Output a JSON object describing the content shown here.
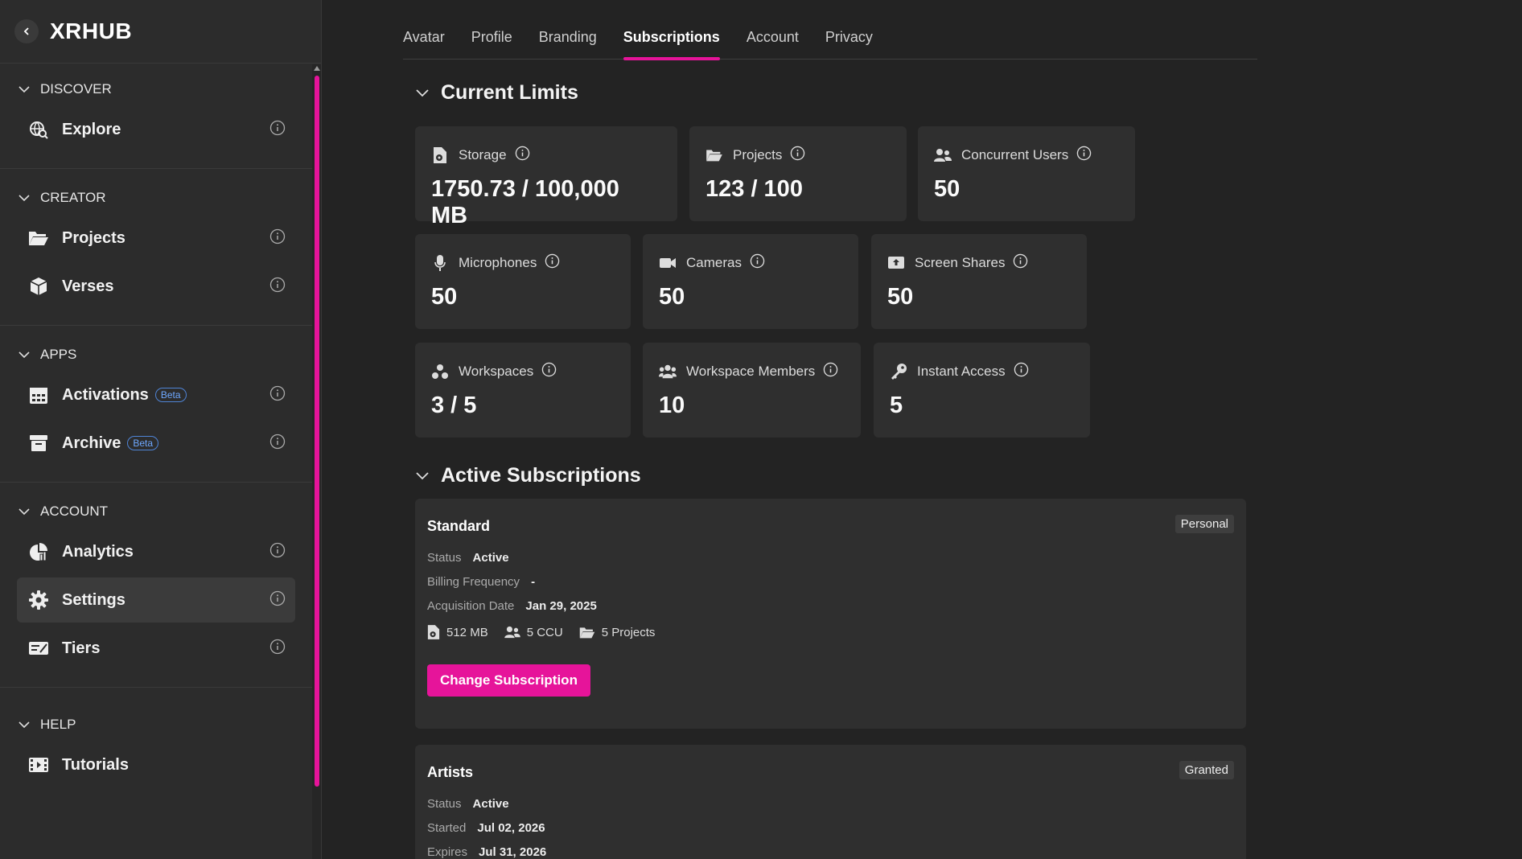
{
  "app": {
    "name": "XRHUB"
  },
  "sidebar": {
    "sections": [
      {
        "title": "DISCOVER",
        "items": [
          {
            "label": "Explore",
            "icon": "globe-search-icon"
          }
        ]
      },
      {
        "title": "CREATOR",
        "items": [
          {
            "label": "Projects",
            "icon": "folder-open-icon"
          },
          {
            "label": "Verses",
            "icon": "cube-icon"
          }
        ]
      },
      {
        "title": "APPS",
        "items": [
          {
            "label": "Activations",
            "icon": "calendar-grid-icon",
            "badge": "Beta"
          },
          {
            "label": "Archive",
            "icon": "archive-box-icon",
            "badge": "Beta"
          }
        ]
      },
      {
        "title": "ACCOUNT",
        "items": [
          {
            "label": "Analytics",
            "icon": "pie-chart-icon"
          },
          {
            "label": "Settings",
            "icon": "gear-icon",
            "active": true
          },
          {
            "label": "Tiers",
            "icon": "ticket-icon"
          }
        ]
      },
      {
        "title": "HELP",
        "items": [
          {
            "label": "Tutorials",
            "icon": "film-icon"
          }
        ]
      }
    ]
  },
  "tabs": [
    {
      "label": "Avatar"
    },
    {
      "label": "Profile"
    },
    {
      "label": "Branding"
    },
    {
      "label": "Subscriptions",
      "active": true
    },
    {
      "label": "Account"
    },
    {
      "label": "Privacy"
    }
  ],
  "current_limits": {
    "title": "Current Limits",
    "cards": [
      {
        "label": "Storage",
        "value": "1750.73 / 100,000 MB",
        "icon": "file-storage-icon"
      },
      {
        "label": "Projects",
        "value": "123 / 100",
        "icon": "folder-open-icon"
      },
      {
        "label": "Concurrent Users",
        "value": "50",
        "icon": "users-icon"
      },
      {
        "label": "Microphones",
        "value": "50",
        "icon": "microphone-icon"
      },
      {
        "label": "Cameras",
        "value": "50",
        "icon": "video-camera-icon"
      },
      {
        "label": "Screen Shares",
        "value": "50",
        "icon": "screen-share-icon"
      },
      {
        "label": "Workspaces",
        "value": "3 / 5",
        "icon": "workspaces-icon"
      },
      {
        "label": "Workspace Members",
        "value": "10",
        "icon": "group-icon"
      },
      {
        "label": "Instant Access",
        "value": "5",
        "icon": "key-icon"
      }
    ]
  },
  "active_subscriptions": {
    "title": "Active Subscriptions",
    "items": [
      {
        "name": "Standard",
        "badge": "Personal",
        "rows": [
          {
            "label": "Status",
            "value": "Active"
          },
          {
            "label": "Billing Frequency",
            "value": "-"
          },
          {
            "label": "Acquisition Date",
            "value": "Jan 29, 2025"
          }
        ],
        "stats": [
          {
            "text": "512 MB",
            "icon": "file-storage-icon"
          },
          {
            "text": "5 CCU",
            "icon": "users-icon"
          },
          {
            "text": "5 Projects",
            "icon": "folder-open-icon"
          }
        ],
        "button": "Change Subscription"
      },
      {
        "name": "Artists",
        "badge": "Granted",
        "rows": [
          {
            "label": "Status",
            "value": "Active"
          },
          {
            "label": "Started",
            "value": "Jul 02, 2026"
          },
          {
            "label": "Expires",
            "value": "Jul 31, 2026"
          }
        ]
      }
    ]
  },
  "colors": {
    "accent": "#e6149a",
    "background": "#232323",
    "card": "#2f2f2f",
    "sidebar": "#2c2c2c"
  }
}
